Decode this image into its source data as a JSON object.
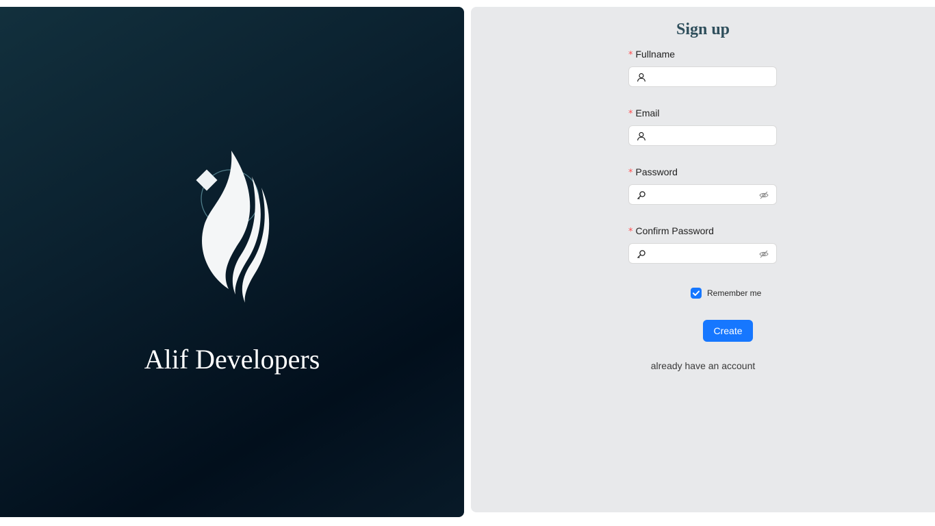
{
  "brand": {
    "name": "Alif Developers",
    "logo_icon": "alif-calligraphy-logo-icon"
  },
  "form": {
    "title": "Sign up",
    "fields": [
      {
        "label": "Fullname",
        "required_mark": "*",
        "value": "",
        "prefix_icon": "user-icon"
      },
      {
        "label": "Email",
        "required_mark": "*",
        "value": "",
        "prefix_icon": "user-icon"
      },
      {
        "label": "Password",
        "required_mark": "*",
        "value": "",
        "prefix_icon": "key-icon",
        "suffix_icon": "eye-invisible-icon"
      },
      {
        "label": "Confirm Password",
        "required_mark": "*",
        "value": "",
        "prefix_icon": "key-icon",
        "suffix_icon": "eye-invisible-icon"
      }
    ],
    "remember": {
      "label": "Remember me",
      "checked": true
    },
    "submit_label": "Create",
    "login_link": "already have an account"
  },
  "colors": {
    "primary": "#1677ff",
    "required": "#ff4d4f",
    "left_panel_bg": "#0a1f2d",
    "right_panel_bg": "#e8e9eb",
    "title": "#2f4f5c"
  }
}
